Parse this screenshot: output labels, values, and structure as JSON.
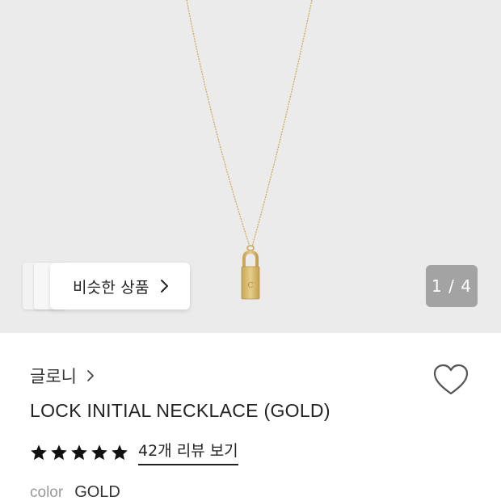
{
  "gallery": {
    "image_alt": "necklace-product-image",
    "similar_label": "비슷한 상품",
    "counter_text": "1 / 4"
  },
  "product": {
    "brand": "글로니",
    "name": "LOCK INITIAL NECKLACE (GOLD)",
    "rating_stars": 5,
    "review_link": "42개 리뷰 보기",
    "option_label": "color",
    "option_value": "GOLD"
  },
  "colors": {
    "hero_bg": "#ebebeb",
    "gold": "#d7b86a",
    "counter_bg": "#a3a3a3",
    "star": "#111111"
  },
  "icons": {
    "similar_chevron": "chevron-right-icon",
    "brand_chevron": "chevron-right-icon",
    "wishlist": "heart-outline-icon",
    "rating": "star-icon"
  }
}
